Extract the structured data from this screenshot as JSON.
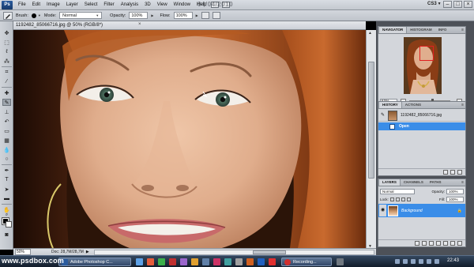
{
  "app": {
    "logo_text": "Ps",
    "menus": [
      "File",
      "Edit",
      "Image",
      "Layer",
      "Select",
      "Filter",
      "Analysis",
      "3D",
      "View",
      "Window",
      "Help"
    ],
    "watermark_date": "04/04/2010",
    "workspace": "CS3",
    "window_controls": [
      "–",
      "□",
      "×"
    ]
  },
  "options_bar": {
    "brush_label": "Brush:",
    "mode_label": "Mode:",
    "mode_value": "Normal",
    "opacity_label": "Opacity:",
    "opacity_value": "100%",
    "flow_label": "Flow:",
    "flow_value": "100%"
  },
  "document": {
    "tab_label": "1192482_85066716.jpg @ 50% (RGB/8*)",
    "close_glyph": "×"
  },
  "status_bar": {
    "zoom": "50%",
    "doc_size": "Doc: 28,7M/28,7M"
  },
  "navigator": {
    "tabs": [
      "Navigator",
      "Histogram",
      "Info"
    ],
    "zoom": "50%"
  },
  "history": {
    "tabs": [
      "History",
      "Actions"
    ],
    "snapshot_label": "1192482_85066716.jpg",
    "states": [
      "Open"
    ]
  },
  "layers": {
    "tabs": [
      "Layers",
      "Channels",
      "Paths"
    ],
    "blend_mode": "Normal",
    "opacity_label": "Opacity:",
    "opacity_value": "100%",
    "lock_label": "Lock:",
    "fill_label": "Fill:",
    "fill_value": "100%",
    "layer_name": "Background"
  },
  "taskbar": {
    "watermark": "www.psdbox.com",
    "tasks": [
      "Adobe Photoshop C...",
      "Recording..."
    ],
    "clock": "22:43"
  },
  "colors": {
    "selection_blue": "#3a8de8",
    "panel_bg": "#d3d6db",
    "chrome_bg": "#c3c8cf",
    "navigator_view_box": "#e02020"
  }
}
